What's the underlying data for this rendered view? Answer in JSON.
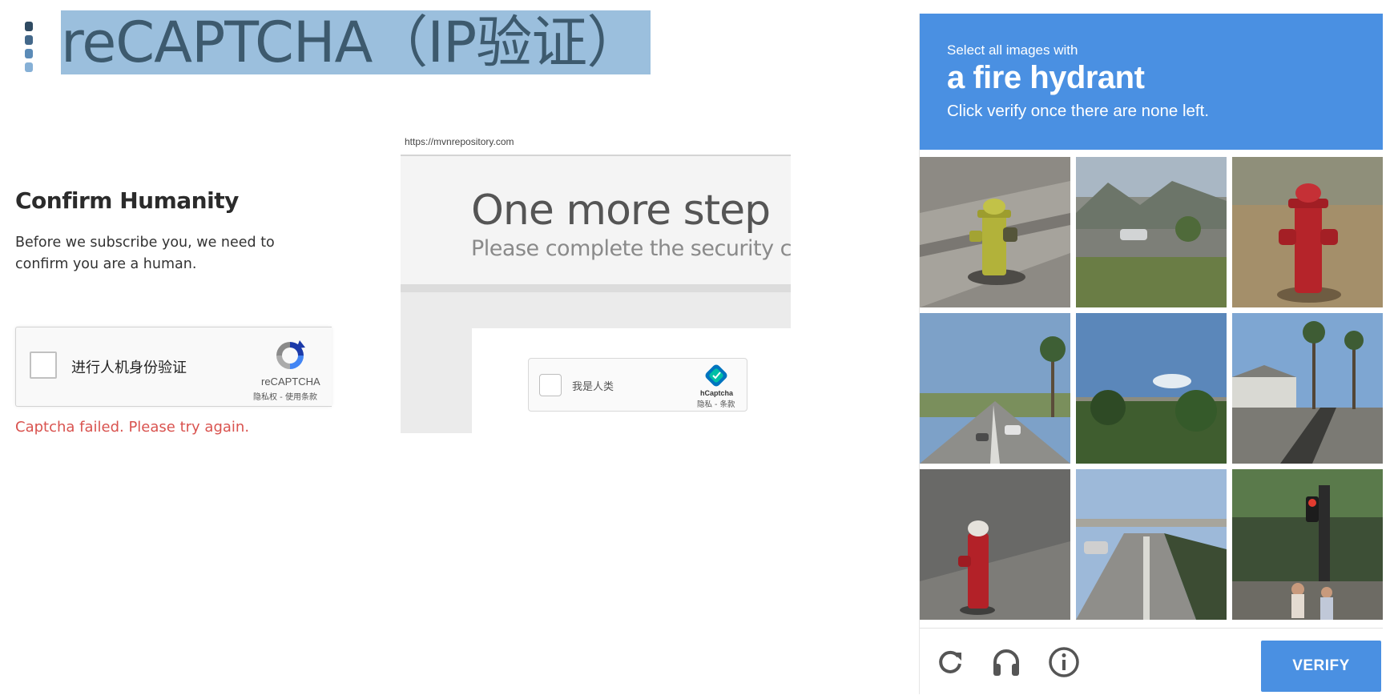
{
  "slide": {
    "title": "reCAPTCHA（IP验证）",
    "colors": {
      "title_bg": "#9bbfdd",
      "title_text": "#3d5a6e",
      "dots": [
        "#2f4a62",
        "#43688a",
        "#5b8bb7",
        "#86b0d6"
      ]
    }
  },
  "recaptcha_form": {
    "heading": "Confirm Humanity",
    "description": "Before we subscribe you, we need to confirm you are a human.",
    "checkbox_label": "进行人机身份验证",
    "brand": "reCAPTCHA",
    "terms": "隐私权 - 使用条款",
    "error": "Captcha failed. Please try again.",
    "colors": {
      "error": "#d9534f"
    }
  },
  "hcaptcha_page": {
    "url": "https://mvnrepository.com",
    "heading": "One more step",
    "subheading": "Please complete the security check",
    "checkbox_label": "我是人类",
    "brand": "hCaptcha",
    "terms": "隐私 - 条款"
  },
  "image_challenge": {
    "prompt_small": "Select all images with",
    "prompt_object": "a fire hydrant",
    "prompt_instruction": "Click verify once there are none left.",
    "verify_label": "VERIFY",
    "colors": {
      "accent": "#4a90e2"
    },
    "footer_icons": [
      "reload-icon",
      "headphones-icon",
      "info-icon"
    ],
    "tiles": [
      "yellow fire hydrant on sidewalk",
      "parking lot with hills",
      "red fire hydrant on dirt",
      "street with palm trees",
      "trees and overpass",
      "building with palm trees",
      "red fire hydrant on pavement",
      "highway with overpass",
      "traffic light and pedestrians"
    ]
  }
}
